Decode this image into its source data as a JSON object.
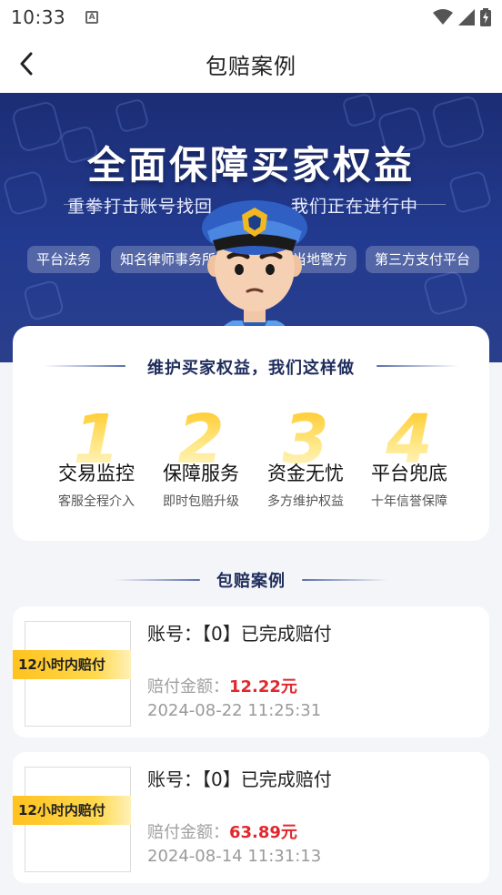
{
  "status_bar": {
    "time": "10:33",
    "notification_icon": "A",
    "icons": [
      "wifi-icon",
      "signal-icon",
      "battery-charging-icon"
    ]
  },
  "nav": {
    "back_icon": "chevron-left-icon",
    "title": "包赔案例"
  },
  "banner": {
    "title": "全面保障买家权益",
    "subtitle_left": "重拳打击账号找回",
    "subtitle_right": "我们正在进行中",
    "tags": [
      "平台法务",
      "知名律师事务所",
      "当地警方",
      "第三方支付平台"
    ],
    "mascot": "police-mascot"
  },
  "features": {
    "heading": "维护买家权益，我们这样做",
    "items": [
      {
        "num": "1",
        "title": "交易监控",
        "desc": "客服全程介入"
      },
      {
        "num": "2",
        "title": "保障服务",
        "desc": "即时包赔升级"
      },
      {
        "num": "3",
        "title": "资金无忧",
        "desc": "多方维护权益"
      },
      {
        "num": "4",
        "title": "平台兜底",
        "desc": "十年信誉保障"
      }
    ]
  },
  "cases": {
    "heading": "包赔案例",
    "items": [
      {
        "badge": "12小时内赔付",
        "account": "账号：【0】已完成赔付",
        "amount_label": "赔付金额：",
        "amount_value": "12.22元",
        "time": "2024-08-22 11:25:31"
      },
      {
        "badge": "12小时内赔付",
        "account": "账号：【0】已完成赔付",
        "amount_label": "赔付金额：",
        "amount_value": "63.89元",
        "time": "2024-08-14 11:31:13"
      }
    ]
  },
  "colors": {
    "banner_bg": "#1f338a",
    "accent_gold": "#ffc928",
    "amount_red": "#e0282e",
    "heading_navy": "#1f2d5c"
  }
}
